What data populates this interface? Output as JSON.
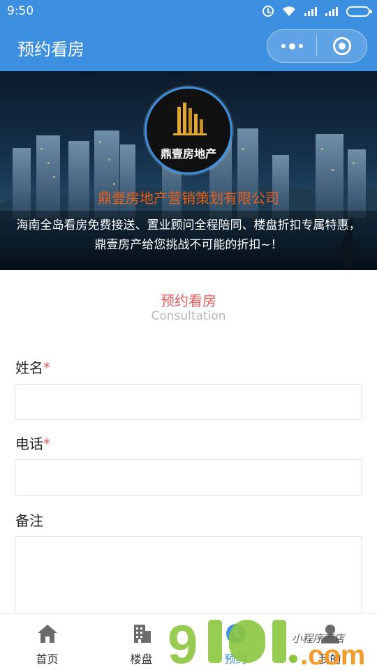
{
  "status_bar": {
    "time": "9:50"
  },
  "nav": {
    "title": "预约看房"
  },
  "banner": {
    "logo_text": "鼎壹房地产",
    "company": "鼎壹房地产营销策划有限公司",
    "description": "海南全岛看房免费接送、置业顾问全程陪同、楼盘折扣专属特惠，鼎壹房产给您挑战不可能的折扣~！"
  },
  "section": {
    "title": "预约看房",
    "subtitle": "Consultation"
  },
  "form": {
    "name": {
      "label": "姓名",
      "required_mark": "*",
      "value": ""
    },
    "phone": {
      "label": "电话",
      "required_mark": "*",
      "value": ""
    },
    "notes": {
      "label": "备注",
      "value": ""
    }
  },
  "tabs": [
    {
      "label": "首页",
      "icon": "home-icon"
    },
    {
      "label": "楼盘",
      "icon": "building-icon"
    },
    {
      "label": "预约",
      "icon": "appointment-icon",
      "active": true
    },
    {
      "label": "我的",
      "icon": "user-icon"
    }
  ],
  "watermark": {
    "text_main": "9",
    "text_domain": ".com",
    "text_script": "小程序商店"
  },
  "colors": {
    "primary": "#3d8fe0",
    "accent_red": "#e55a5a",
    "company_orange": "#e8601c",
    "watermark_green": "#8cc63f"
  }
}
